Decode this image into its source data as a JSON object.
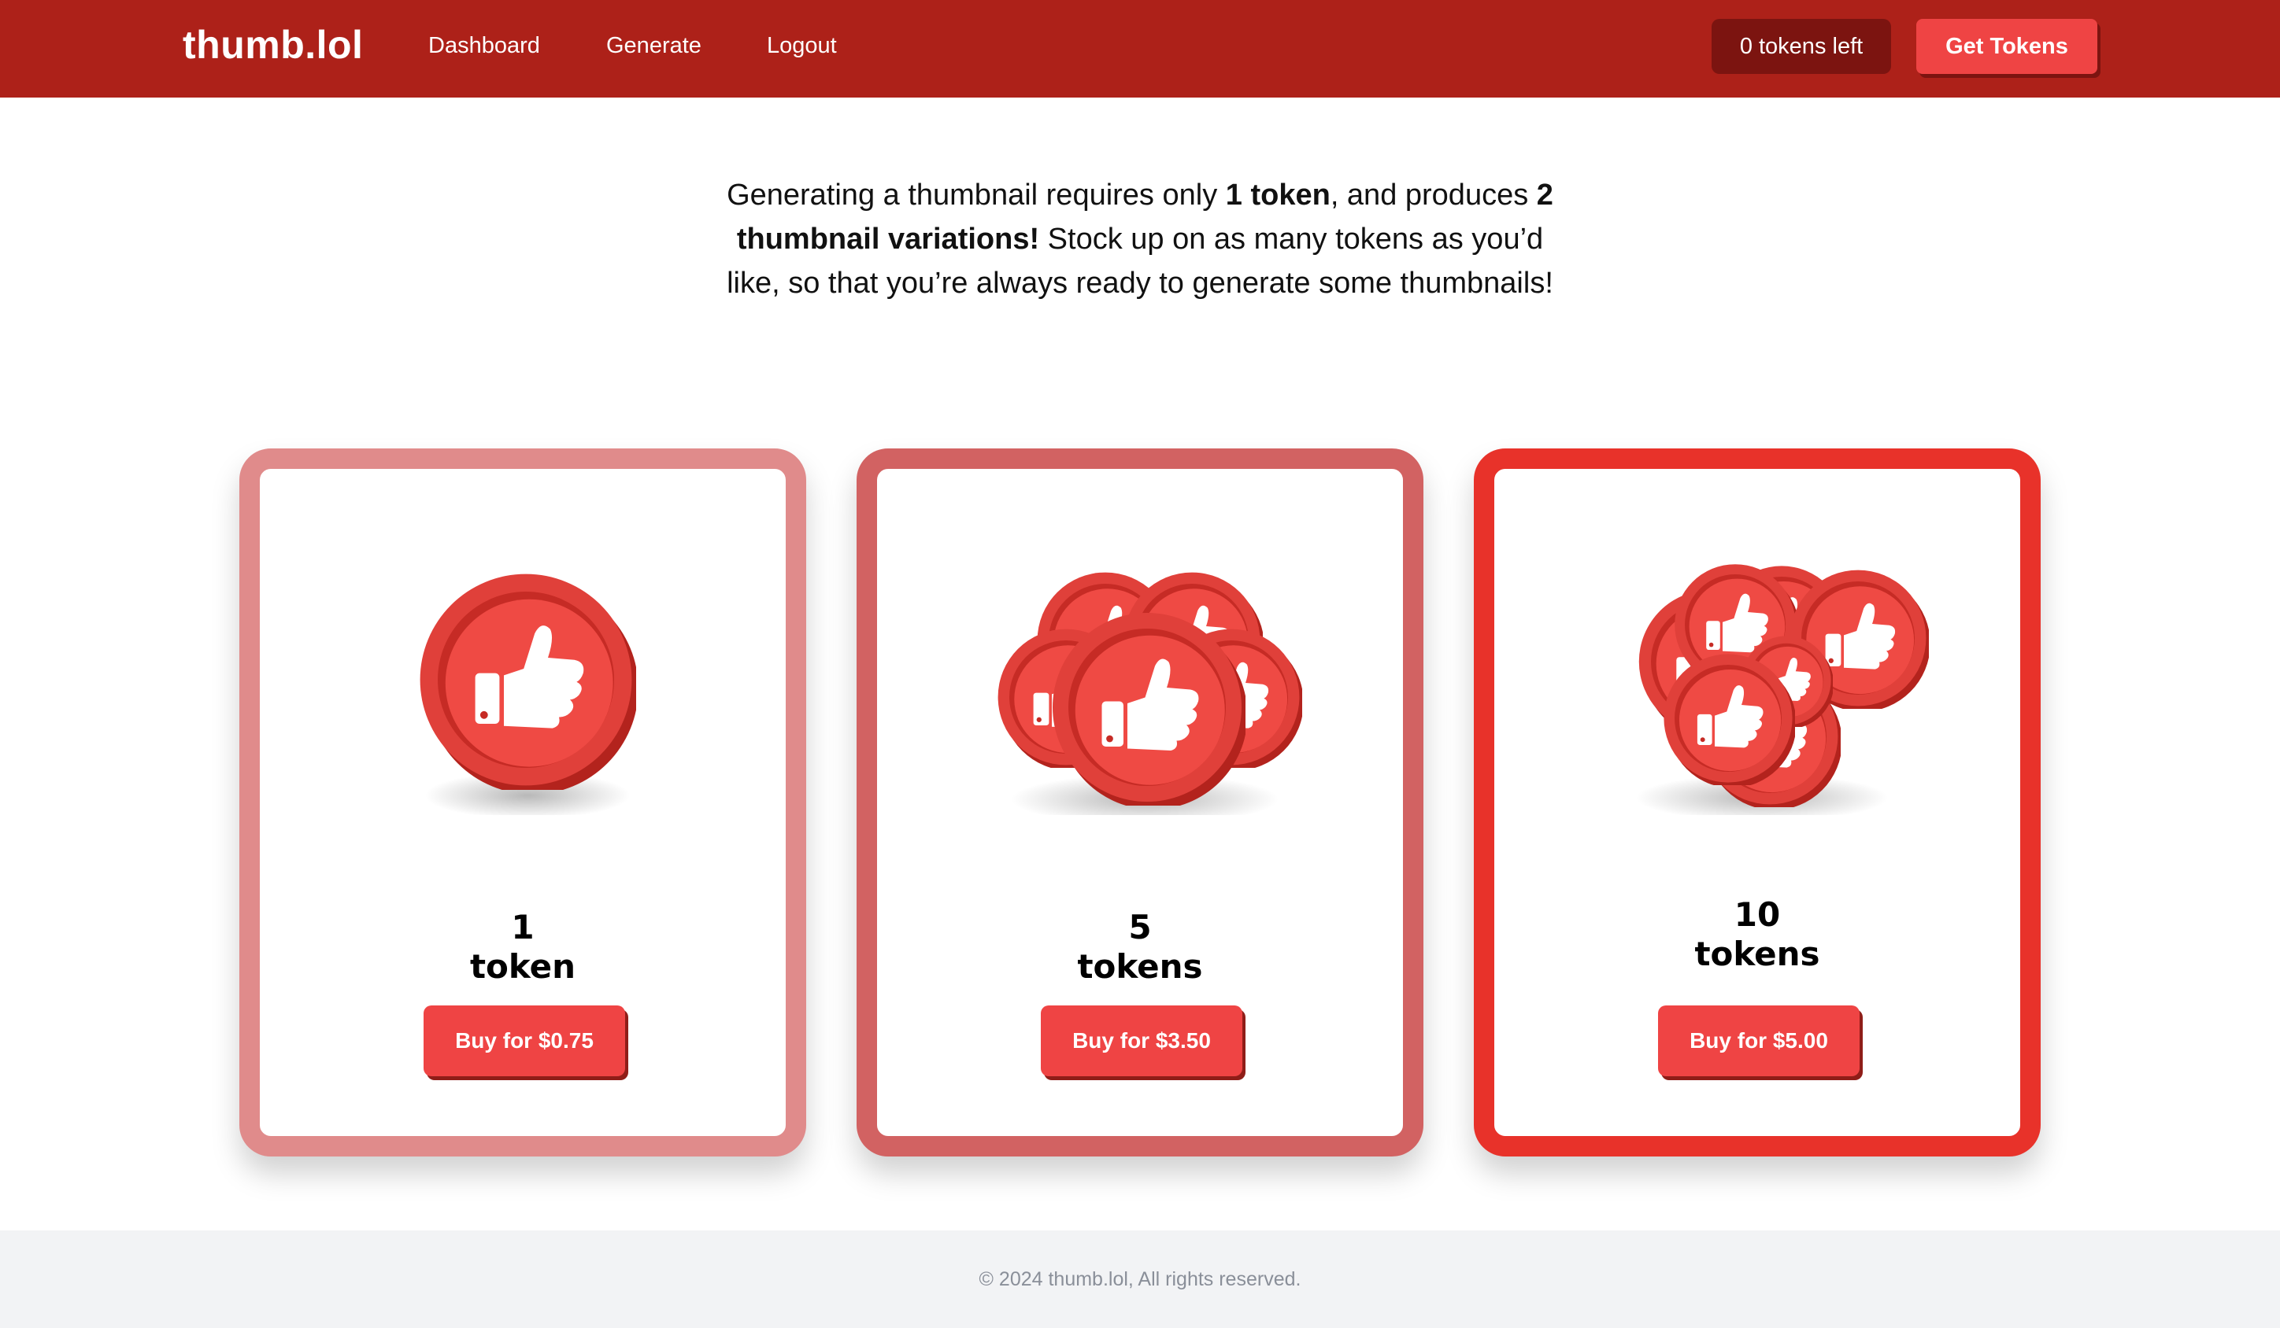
{
  "header": {
    "logo": "thumb.lol",
    "nav": [
      "Dashboard",
      "Generate",
      "Logout"
    ],
    "tokens_left": "0 tokens left",
    "get_tokens": "Get Tokens"
  },
  "intro": {
    "p1": "Generating a thumbnail requires only ",
    "b1": "1 token",
    "p2": ", and produces ",
    "b2": "2 thumbnail variations!",
    "p3": " Stock up on as many tokens as you’d like, so that you’re always ready to generate some thumbnails!"
  },
  "cards": [
    {
      "count": "1",
      "unit": "token",
      "button": "Buy for $0.75",
      "border_color": "#e08b8b",
      "icon": "single-thumbs-up-coin"
    },
    {
      "count": "5",
      "unit": "tokens",
      "button": "Buy for $3.50",
      "border_color": "#d26262",
      "icon": "five-thumbs-up-coins"
    },
    {
      "count": "10",
      "unit": "tokens",
      "button": "Buy for $5.00",
      "border_color": "#e8322a",
      "icon": "ten-thumbs-up-coins"
    }
  ],
  "footer": {
    "text": "© 2024 thumb.lol, All rights reserved."
  },
  "colors": {
    "header_bg": "#ad2119",
    "accent": "#ef4444",
    "pill_bg": "#7c1410",
    "footer_bg": "#f2f3f5"
  }
}
